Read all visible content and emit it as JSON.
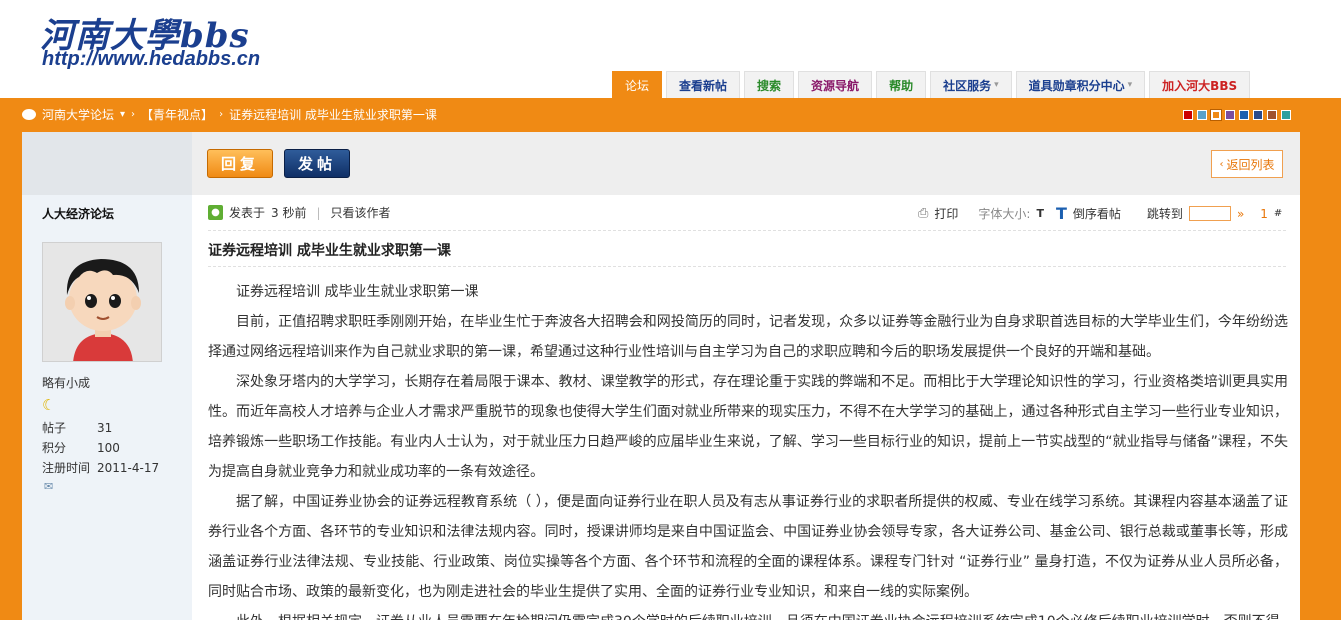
{
  "header": {
    "logo_title": "河南大學bbs",
    "logo_url": "http://www.hedabbs.cn"
  },
  "nav": {
    "tabs": [
      {
        "label": "论坛",
        "active": true,
        "color": "#ffffff",
        "caret": false
      },
      {
        "label": "查看新帖",
        "color": "#1b3f8f",
        "caret": false
      },
      {
        "label": "搜索",
        "color": "#2a8a2a",
        "caret": false
      },
      {
        "label": "资源导航",
        "color": "#8a1a6a",
        "caret": false
      },
      {
        "label": "帮助",
        "color": "#2a8a2a",
        "caret": false
      },
      {
        "label": "社区服务",
        "color": "#1b3f8f",
        "caret": true
      },
      {
        "label": "道具勋章积分中心",
        "color": "#1b3f8f",
        "caret": true
      },
      {
        "label": "加入河大BBS",
        "color": "#cc2222",
        "caret": false
      }
    ]
  },
  "breadcrumb": {
    "home": "河南大学论坛",
    "forum": "【青年视点】",
    "thread": "证券远程培训 成毕业生就业求职第一课"
  },
  "style_swatches": [
    "#cc0000",
    "#5aa0c8",
    "#f08a14",
    "#7a4ea0",
    "#1a5fb0",
    "#2a4a8a",
    "#a0522d",
    "#2aa0a0"
  ],
  "buttons": {
    "reply": "回复",
    "post": "发帖",
    "back": "返回列表"
  },
  "author": {
    "name": "人大经济论坛",
    "title": "略有小成",
    "stats": [
      {
        "label": "帖子",
        "value": "31"
      },
      {
        "label": "积分",
        "value": "100"
      },
      {
        "label": "注册时间",
        "value": "2011-4-17"
      }
    ]
  },
  "post_meta": {
    "posted": "发表于",
    "time": "3 秒前",
    "only_author": "只看该作者",
    "print": "打印",
    "font_size": "字体大小:",
    "font_small": "T",
    "font_large": "T",
    "reverse": "倒序看帖",
    "jump": "跳转到",
    "jump_arrow": "»",
    "floor": "1",
    "floor_mark": "#"
  },
  "post": {
    "title": "证券远程培训 成毕业生就业求职第一课",
    "subtitle": "证券远程培训 成毕业生就业求职第一课",
    "p1": "目前，正值招聘求职旺季刚刚开始，在毕业生忙于奔波各大招聘会和网投简历的同时，记者发现，众多以证券等金融行业为自身求职首选目标的大学毕业生们，今年纷纷选择通过网络远程培训来作为自己就业求职的第一课，希望通过这种行业性培训与自主学习为自己的求职应聘和今后的职场发展提供一个良好的开端和基础。",
    "p2": "深处象牙塔内的大学学习，长期存在着局限于课本、教材、课堂教学的形式，存在理论重于实践的弊端和不足。而相比于大学理论知识性的学习，行业资格类培训更具实用性。而近年高校人才培养与企业人才需求严重脱节的现象也使得大学生们面对就业所带来的现实压力，不得不在大学学习的基础上，通过各种形式自主学习一些行业专业知识，培养锻炼一些职场工作技能。有业内人士认为，对于就业压力日趋严峻的应届毕业生来说，了解、学习一些目标行业的知识，提前上一节实战型的“就业指导与储备”课程，不失为提高自身就业竞争力和就业成功率的一条有效途径。",
    "p3": "据了解，中国证券业协会的证券远程教育系统（ ），便是面向证券行业在职人员及有志从事证券行业的求职者所提供的权威、专业在线学习系统。其课程内容基本涵盖了证券行业各个方面、各环节的专业知识和法律法规内容。同时，授课讲师均是来自中国证监会、中国证券业协会领导专家，各大证券公司、基金公司、银行总裁或董事长等，形成涵盖证券行业法律法规、专业技能、行业政策、岗位实操等各个方面、各个环节和流程的全面的课程体系。课程专门针对 “证券行业” 量身打造，不仅为证券从业人员所必备，同时贴合市场、政策的最新变化，也为刚走进社会的毕业生提供了实用、全面的证券行业专业知识，和来自一线的实际案例。",
    "p4": "此外，根据相关规定，证券从业人员需要在年检期间仍需完成30个学时的后续职业培训，且须在中国证券业协会远程培训系统完成10个必修后续职业培训学时，否则不得"
  }
}
